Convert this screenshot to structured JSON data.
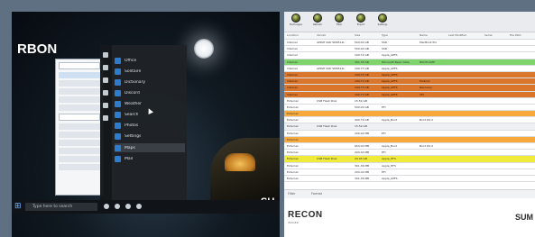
{
  "colors": {
    "background": "#5e7081",
    "row_green": "#7ed36b",
    "row_orange": "#d9762b",
    "row_yellow": "#f0ea3b",
    "row_light_orange": "#f7a93b",
    "start_menu_bg": "#1f2327"
  },
  "left_screen": {
    "brand": "RBON",
    "brand_right": "SU",
    "start_menu": {
      "apps": [
        "Office",
        "Solitaire",
        "Dictionary",
        "Discord",
        "Weather",
        "Search",
        "Photos",
        "Settings",
        "Maps",
        "Mail"
      ]
    },
    "taskbar": {
      "search_placeholder": "Type here to search"
    }
  },
  "right_screen": {
    "toolbar": [
      "Exchanges",
      "Refresh",
      "Filter",
      "Export",
      "Settings"
    ],
    "columns": [
      "Location",
      "Vendor",
      "Size",
      "Type",
      "Name",
      "Last Modified",
      "Serial",
      "File Path"
    ],
    "rows": [
      {
        "style": "plain",
        "cells": [
          "Internal",
          "APPLE SSD SM0512L",
          "500.00 GB",
          "SSD",
          "MacBook Pro"
        ]
      },
      {
        "style": "plain",
        "cells": [
          "Internal",
          "",
          "500.00 GB",
          "SSD",
          ""
        ]
      },
      {
        "style": "plain",
        "cells": [
          "Internal",
          "",
          "199.72 GB",
          "Apple_APFS",
          ""
        ]
      },
      {
        "style": "green",
        "cells": [
          "Internal",
          "",
          "301.35 GB",
          "Microsoft Basic Data",
          "BOOTCAMP"
        ]
      },
      {
        "style": "plain",
        "cells": [
          "Internal",
          "APPLE SSD SM0512L",
          "199.73 GB",
          "Apple_APFS",
          ""
        ]
      },
      {
        "style": "orange",
        "cells": [
          "Internal",
          "",
          "199.73 GB",
          "Apple_APFS",
          ""
        ]
      },
      {
        "style": "orange",
        "cells": [
          "Internal",
          "",
          "199.73 GB",
          "Apple_APFS",
          "Preboot"
        ]
      },
      {
        "style": "orange",
        "cells": [
          "Internal",
          "",
          "199.73 GB",
          "Apple_APFS",
          "Recovery"
        ]
      },
      {
        "style": "orange",
        "cells": [
          "Internal",
          "",
          "199.73 GB",
          "Apple_APFS",
          "VM"
        ]
      },
      {
        "style": "plain",
        "cells": [
          "External",
          "USB Flash Disk",
          "15.59 GB",
          "",
          ""
        ]
      },
      {
        "style": "plain",
        "cells": [
          "External",
          "",
          "500.00 GB",
          "EFI",
          ""
        ]
      },
      {
        "style": "lorange",
        "cells": [
          "External",
          "",
          "",
          "",
          ""
        ]
      },
      {
        "style": "plain",
        "cells": [
          "External",
          "",
          "499.79 GB",
          "Apple_Boot",
          "Boot OS X"
        ]
      },
      {
        "style": "grey",
        "cells": [
          "External",
          "USB Flash Disk",
          "15.59 GB",
          "",
          ""
        ]
      },
      {
        "style": "plain",
        "cells": [
          "External",
          "",
          "200.00 MB",
          "EFI",
          ""
        ]
      },
      {
        "style": "lorange",
        "cells": [
          "External",
          "",
          "",
          "",
          ""
        ]
      },
      {
        "style": "plain",
        "cells": [
          "External",
          "",
          "650.00 MB",
          "Apple_Boot",
          "Boot OS X"
        ]
      },
      {
        "style": "plain",
        "cells": [
          "External",
          "",
          "200.00 MB",
          "EFI",
          ""
        ]
      },
      {
        "style": "yellow",
        "cells": [
          "External",
          "USB Flash Disk",
          "29.93 GB",
          "Apple_HFS",
          ""
        ]
      },
      {
        "style": "plain",
        "cells": [
          "External",
          "",
          "301.36 MB",
          "Apple_HFS",
          ""
        ]
      },
      {
        "style": "plain",
        "cells": [
          "External",
          "",
          "200.00 MB",
          "EFI",
          ""
        ]
      },
      {
        "style": "plain",
        "cells": [
          "External",
          "",
          "301.36 MB",
          "Apple_APFS",
          ""
        ]
      }
    ],
    "filter_label": "Filter",
    "filter_value": "Format",
    "brand": "RECON",
    "brand_sub": "IMAGER",
    "brand_right": "SUM"
  }
}
